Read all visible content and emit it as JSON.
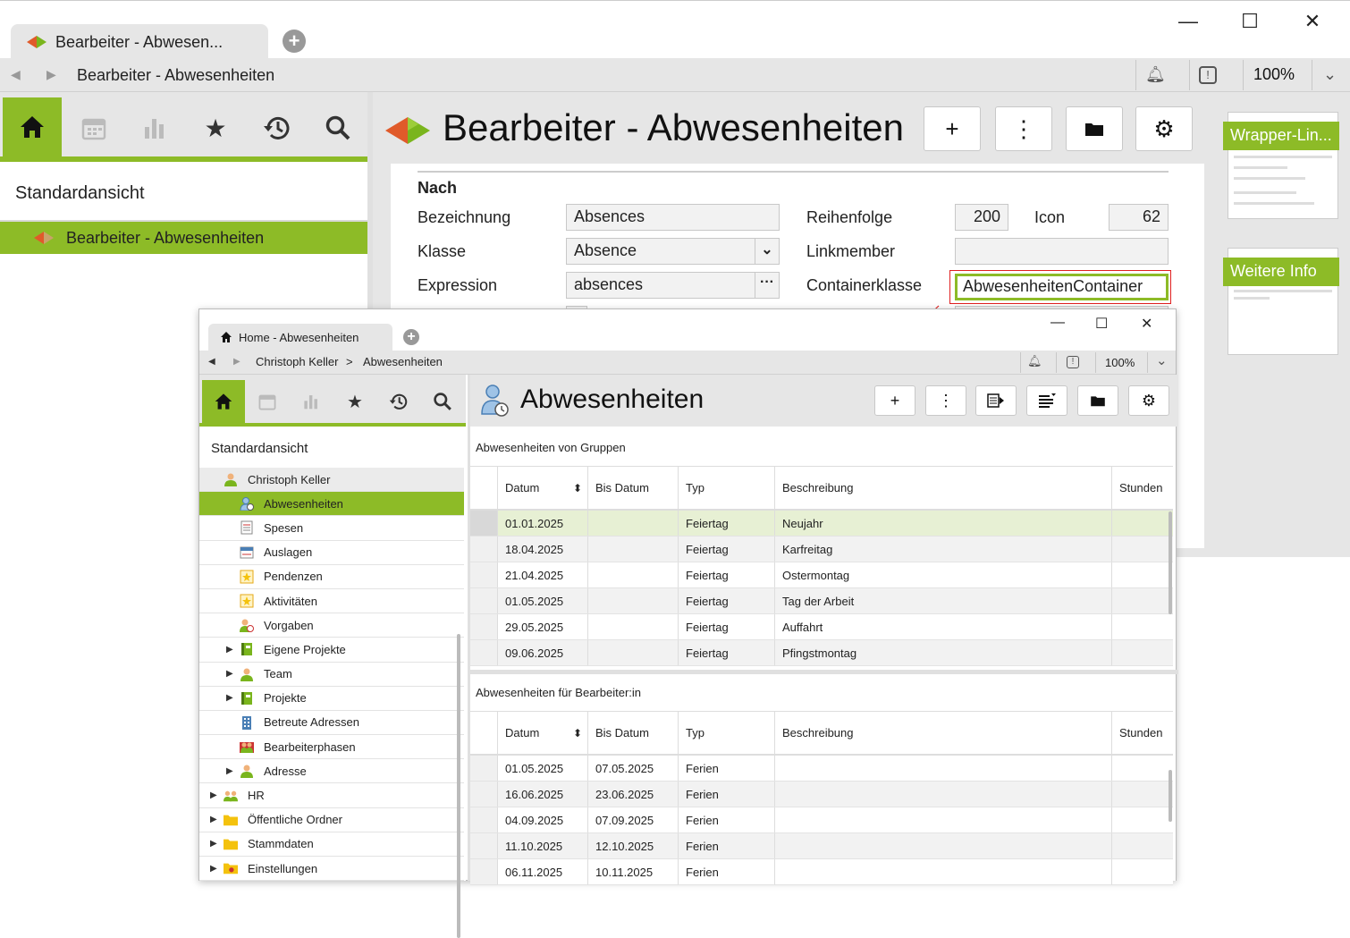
{
  "window": {
    "tab_title": "Bearbeiter - Abwesen...",
    "new_tab": "+",
    "minimize": "—",
    "maximize": "☐",
    "close": "✕",
    "breadcrumb": "Bearbeiter - Abwesenheiten",
    "zoom": "100%"
  },
  "sidebar": {
    "view_label": "Standardansicht",
    "selected_item": "Bearbeiter - Abwesenheiten"
  },
  "main": {
    "title": "Bearbeiter - Abwesenheiten",
    "section": "Nach",
    "fields": {
      "bezeichnung_label": "Bezeichnung",
      "bezeichnung_value": "Absences",
      "klasse_label": "Klasse",
      "klasse_value": "Absence",
      "expression_label": "Expression",
      "expression_value": "absences",
      "reihenfolge_label": "Reihenfolge",
      "reihenfolge_value": "200",
      "icon_label": "Icon",
      "icon_value": "62",
      "linkmember_label": "Linkmember",
      "linkmember_value": "",
      "containerklasse_label": "Containerklasse",
      "containerklasse_value": "AbwesenheitenContainer"
    }
  },
  "right_panel": {
    "thumb1_title": "Wrapper-Lin...",
    "thumb2_title": "Weitere Info"
  },
  "inner": {
    "tab_title": "Home - Abwesenheiten",
    "breadcrumb_1": "Christoph Keller",
    "breadcrumb_sep": ">",
    "breadcrumb_2": "Abwesenheiten",
    "zoom": "100%",
    "view_label": "Standardansicht",
    "title": "Abwesenheiten",
    "tree": [
      {
        "label": "Christoph Keller",
        "icon": "person-icon"
      },
      {
        "label": "Abwesenheiten",
        "icon": "absence-icon"
      },
      {
        "label": "Spesen",
        "icon": "receipt-icon"
      },
      {
        "label": "Auslagen",
        "icon": "expense-icon"
      },
      {
        "label": "Pendenzen",
        "icon": "star-box-icon"
      },
      {
        "label": "Aktivitäten",
        "icon": "star-box-icon"
      },
      {
        "label": "Vorgaben",
        "icon": "person-target-icon"
      },
      {
        "label": "Eigene Projekte",
        "icon": "project-icon"
      },
      {
        "label": "Team",
        "icon": "person-icon"
      },
      {
        "label": "Projekte",
        "icon": "project-icon"
      },
      {
        "label": "Betreute Adressen",
        "icon": "building-icon"
      },
      {
        "label": "Bearbeiterphasen",
        "icon": "phases-icon"
      },
      {
        "label": "Adresse",
        "icon": "person-icon"
      },
      {
        "label": "HR",
        "icon": "group-icon"
      },
      {
        "label": "Öffentliche Ordner",
        "icon": "folder-icon"
      },
      {
        "label": "Stammdaten",
        "icon": "folder-icon"
      },
      {
        "label": "Einstellungen",
        "icon": "settings-folder-icon"
      }
    ],
    "grid1": {
      "title": "Abwesenheiten von Gruppen",
      "columns": [
        "Datum",
        "Bis Datum",
        "Typ",
        "Beschreibung",
        "Stunden"
      ],
      "rows": [
        [
          "01.01.2025",
          "",
          "Feiertag",
          "Neujahr",
          ""
        ],
        [
          "18.04.2025",
          "",
          "Feiertag",
          "Karfreitag",
          ""
        ],
        [
          "21.04.2025",
          "",
          "Feiertag",
          "Ostermontag",
          ""
        ],
        [
          "01.05.2025",
          "",
          "Feiertag",
          "Tag der Arbeit",
          ""
        ],
        [
          "29.05.2025",
          "",
          "Feiertag",
          "Auffahrt",
          ""
        ],
        [
          "09.06.2025",
          "",
          "Feiertag",
          "Pfingstmontag",
          ""
        ]
      ]
    },
    "grid2": {
      "title": "Abwesenheiten für Bearbeiter:in",
      "columns": [
        "Datum",
        "Bis Datum",
        "Typ",
        "Beschreibung",
        "Stunden"
      ],
      "rows": [
        [
          "01.05.2025",
          "07.05.2025",
          "Ferien",
          "",
          ""
        ],
        [
          "16.06.2025",
          "23.06.2025",
          "Ferien",
          "",
          ""
        ],
        [
          "04.09.2025",
          "07.09.2025",
          "Ferien",
          "",
          ""
        ],
        [
          "11.10.2025",
          "12.10.2025",
          "Ferien",
          "",
          ""
        ],
        [
          "06.11.2025",
          "10.11.2025",
          "Ferien",
          "",
          ""
        ]
      ]
    }
  },
  "colors": {
    "accent": "#8dbb27",
    "annotation": "#e02020"
  }
}
